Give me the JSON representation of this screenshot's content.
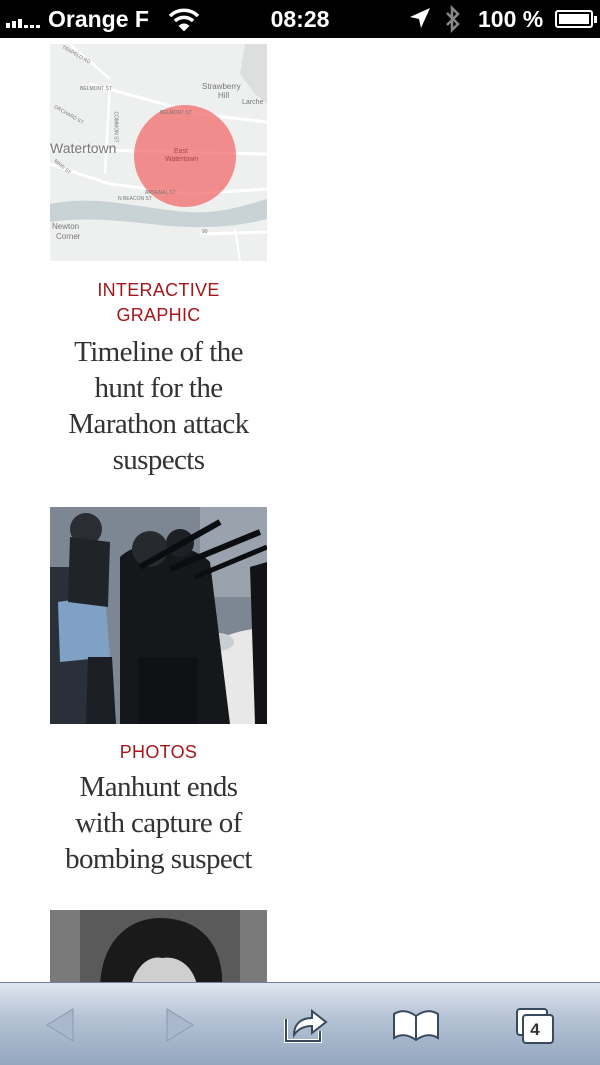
{
  "status_bar": {
    "carrier": "Orange F",
    "time": "08:28",
    "battery_percent": "100 %",
    "battery_level": 1.0,
    "icons": [
      "signal-icon",
      "wifi-icon",
      "location-arrow-icon",
      "bluetooth-icon",
      "battery-icon"
    ]
  },
  "articles": [
    {
      "kicker_line1": "INTERACTIVE",
      "kicker_line2": "GRAPHIC",
      "headline_lines": [
        "Timeline of the",
        "hunt for the",
        "Marathon attack",
        "suspects"
      ],
      "thumbnail": "map-thumbnail",
      "map_labels": {
        "watertown": "Watertown",
        "east_watertown_1": "East",
        "east_watertown_2": "Watertown",
        "strawberry_hill_1": "Strawberry",
        "strawberry_hill_2": "Hill",
        "newton_corner_1": "Newton",
        "newton_corner_2": "Corner",
        "belmont_st": "BELMONT ST",
        "belmont_st_2": "BELMONT ST",
        "arsenal_st": "ARSENAL ST",
        "n_beacon_st": "N BEACON ST",
        "orchard_st": "ORCHARD ST",
        "common_st": "COMMON ST",
        "main_st": "MAIN ST",
        "trapelo_rd": "TRAPELO RD",
        "larches": "Larche",
        "route_90": "90"
      }
    },
    {
      "kicker_line1": "PHOTOS",
      "headline_lines": [
        "Manhunt ends",
        "with capture of",
        "bombing suspect"
      ],
      "thumbnail": "photo-thumbnail"
    },
    {
      "thumbnail": "portrait-thumbnail"
    }
  ],
  "toolbar": {
    "tabs_count": "4",
    "colors": {
      "gradient_top": "#dfe6ef",
      "gradient_bottom": "#95a7bf",
      "disabled_arrow": "#9aaac1"
    }
  },
  "colors": {
    "kicker": "#a5161b",
    "headline": "#333333",
    "status_bar_bg": "#000000"
  }
}
